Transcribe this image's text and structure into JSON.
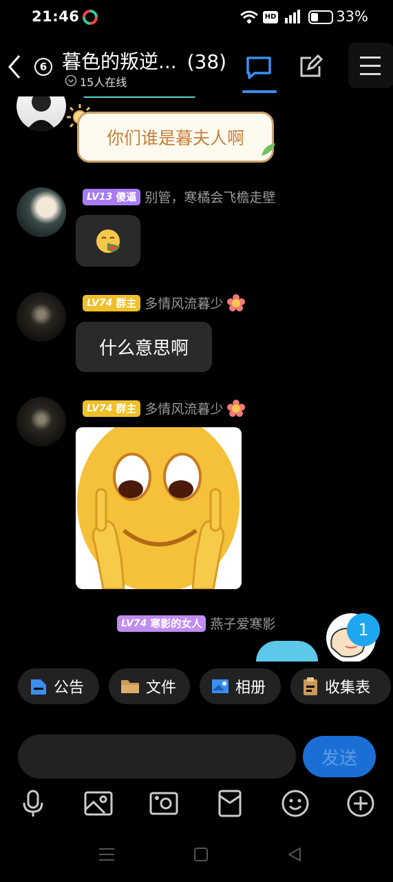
{
  "status_bar": {
    "time": "21:46",
    "battery": "33%"
  },
  "header": {
    "unread_count": "6",
    "title": "暮色的叛逆...",
    "member_count": "(38)",
    "online": "15人在线"
  },
  "messages": [
    {
      "text": "你们谁是暮夫人啊"
    },
    {
      "level": "LV13",
      "title": "傻逼",
      "name": "别管，寒橘会飞檐走壁",
      "badge_color": "#a77cf5"
    },
    {
      "level": "LV74",
      "title": "群主",
      "name": "多情风流暮少",
      "badge_color": "#f0c02a",
      "text": "什么意思啊"
    },
    {
      "level": "LV74",
      "title": "群主",
      "name": "多情风流暮少",
      "badge_color": "#f0c02a"
    },
    {
      "level": "LV74",
      "title": "寒影的女人",
      "name": "燕子爱寒影",
      "badge_color": "#c08df0"
    }
  ],
  "new_message_count": "1",
  "quick_actions": [
    {
      "label": "公告",
      "icon": "announcement-icon"
    },
    {
      "label": "文件",
      "icon": "folder-icon"
    },
    {
      "label": "相册",
      "icon": "album-icon"
    },
    {
      "label": "收集表",
      "icon": "clipboard-icon"
    }
  ],
  "input": {
    "placeholder": "",
    "send_label": "发送"
  },
  "toolbar_icons": [
    "microphone-icon",
    "image-icon",
    "camera-icon",
    "red-packet-icon",
    "emoji-icon",
    "plus-icon"
  ],
  "colors": {
    "accent": "#3a8ff0",
    "send_button": "#1b6fd4"
  }
}
